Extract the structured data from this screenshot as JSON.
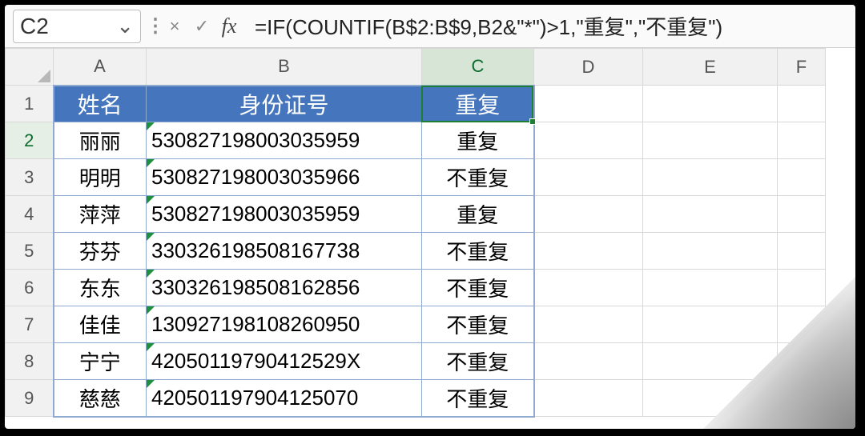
{
  "nameBox": "C2",
  "formula": "=IF(COUNTIF(B$2:B$9,B2&\"*\")>1,\"重复\",\"不重复\")",
  "icons": {
    "cancel": "×",
    "confirm": "✓",
    "fx": "fx",
    "chevron": "⌄",
    "dots": "⋮"
  },
  "columnHeaders": [
    "A",
    "B",
    "C",
    "D",
    "E",
    "F"
  ],
  "rowHeaders": [
    "1",
    "2",
    "3",
    "4",
    "5",
    "6",
    "7",
    "8",
    "9"
  ],
  "activeCell": {
    "col": "C",
    "row": 2
  },
  "tableHeader": {
    "A": "姓名",
    "B": "身份证号",
    "C": "重复"
  },
  "rows": [
    {
      "A": "丽丽",
      "B": "530827198003035959",
      "C": "重复"
    },
    {
      "A": "明明",
      "B": "530827198003035966",
      "C": "不重复"
    },
    {
      "A": "萍萍",
      "B": "530827198003035959",
      "C": "重复"
    },
    {
      "A": "芬芬",
      "B": "330326198508167738",
      "C": "不重复"
    },
    {
      "A": "东东",
      "B": "330326198508162856",
      "C": "不重复"
    },
    {
      "A": "佳佳",
      "B": "130927198108260950",
      "C": "不重复"
    },
    {
      "A": "宁宁",
      "B": "42050119790412529X",
      "C": "不重复"
    },
    {
      "A": "慈慈",
      "B": "420501197904125070",
      "C": "不重复"
    }
  ],
  "colors": {
    "headerFill": "#4576bd",
    "selection": "#1e7e34"
  }
}
